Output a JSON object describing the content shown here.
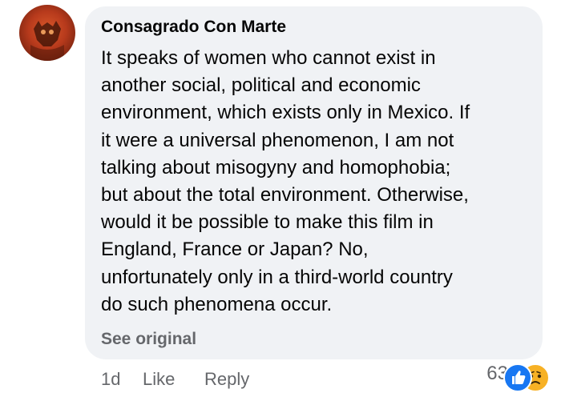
{
  "comment": {
    "author": "Consagrado Con Marte",
    "text_lines": [
      "It speaks of women who cannot exist in",
      "another social, political and economic",
      "environment, which exists only in Mexico. If",
      "it were a universal phenomenon, I am not",
      "talking about misogyny and homophobia;",
      "but about the total environment. Otherwise,",
      "would it be possible to make this film in",
      "England, France or Japan? No,",
      "unfortunately only in a third-world country",
      "do such phenomena occur."
    ],
    "see_original_label": "See original",
    "timestamp": "1d",
    "like_label": "Like",
    "reply_label": "Reply",
    "reaction_count": "63",
    "reactions": [
      "like-icon",
      "sad-face-icon"
    ]
  },
  "colors": {
    "bubble_bg": "#f0f2f5",
    "secondary_text": "#65676b",
    "like_blue": "#1877f2",
    "sad_yellow": "#f7b125"
  }
}
